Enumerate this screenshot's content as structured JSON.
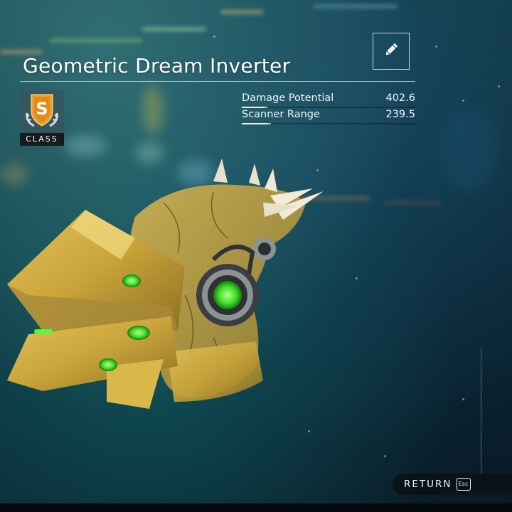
{
  "item": {
    "name": "Geometric Dream Inverter"
  },
  "class_badge": {
    "letter": "S",
    "label": "CLASS",
    "color": "#f0a030"
  },
  "stats": [
    {
      "label": "Damage Potential",
      "value": "402.6",
      "fill": 0.13
    },
    {
      "label": "Scanner Range",
      "value": "239.5",
      "fill": 0.15
    }
  ],
  "controls": {
    "edit_icon": "pencil-icon",
    "return_label": "RETURN",
    "return_key": "Esc"
  },
  "colors": {
    "accent_orange": "#f2a93b",
    "weapon_gold": "#c9a43a",
    "glow_green": "#4cff3a"
  }
}
